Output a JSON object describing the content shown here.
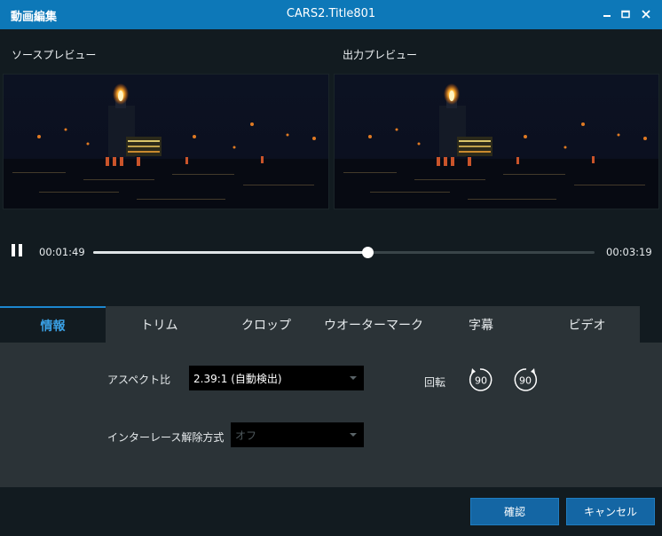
{
  "window": {
    "app_title": "動画編集",
    "document_title": "CARS2.Title801",
    "minimize_label": "‒",
    "maximize_label": "▭",
    "close_label": "✕"
  },
  "preview": {
    "source_label": "ソースプレビュー",
    "output_label": "出力プレビュー"
  },
  "playback": {
    "current_time": "00:01:49",
    "total_time": "00:03:19",
    "progress": 0.547
  },
  "tabs": [
    {
      "label": "情報",
      "active": true
    },
    {
      "label": "トリム",
      "active": false
    },
    {
      "label": "クロップ",
      "active": false
    },
    {
      "label": "ウオーターマーク",
      "active": false
    },
    {
      "label": "字幕",
      "active": false
    },
    {
      "label": "ビデオ",
      "active": false
    }
  ],
  "info": {
    "aspect_label": "アスペクト比",
    "aspect_value": "2.39:1 (自動検出)",
    "deinterlace_label": "インターレース解除方式",
    "deinterlace_value": "オフ",
    "rotate_label": "回転",
    "rotate_left_value": "90",
    "rotate_right_value": "90"
  },
  "footer": {
    "confirm_label": "確認",
    "cancel_label": "キャンセル"
  },
  "colors": {
    "titlebar": "#0d78b8",
    "accent": "#3aa0e4",
    "button": "#1466a4",
    "panel": "#2b3337",
    "background": "#121b20"
  }
}
